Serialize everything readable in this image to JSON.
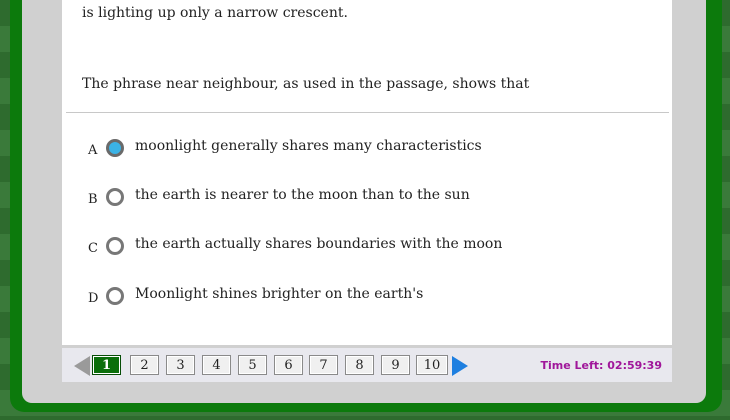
{
  "passage": {
    "tail_text": "is lighting up only a narrow crescent."
  },
  "question": {
    "text": "The phrase near neighbour, as used in the passage, shows that"
  },
  "options": [
    {
      "letter": "A",
      "text": "moonlight generally shares many characteristics",
      "selected": true
    },
    {
      "letter": "B",
      "text": "the earth is nearer to the moon than to the sun",
      "selected": false
    },
    {
      "letter": "C",
      "text": "the earth actually shares boundaries with the moon",
      "selected": false
    },
    {
      "letter": "D",
      "text": "Moonlight shines brighter on the earth's",
      "selected": false
    }
  ],
  "pagination": {
    "pages": [
      "1",
      "2",
      "3",
      "4",
      "5",
      "6",
      "7",
      "8",
      "9",
      "10"
    ],
    "current": "1"
  },
  "timer": {
    "text": "Time Left: 02:59:39"
  },
  "colors": {
    "accent_green": "#0a6e0a",
    "radio_selected": "#3bb3e6",
    "timer": "#a0169a",
    "next_arrow": "#1e7fe0"
  }
}
